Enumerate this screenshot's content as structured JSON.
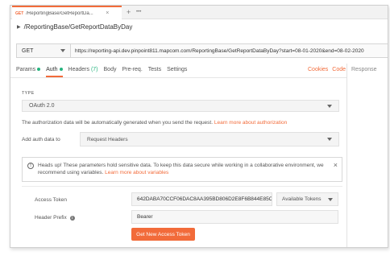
{
  "tab": {
    "method": "GET",
    "name": "/ReportingBase/GetReportDa...",
    "close_icon": "×",
    "new_tab": "+",
    "more": "•••"
  },
  "breadcrumb": {
    "title": "/ReportingBase/GetReportDataByDay"
  },
  "request": {
    "method": "GET",
    "url": "https://reporting-api.dev.pinpoint811.mapcom.com/ReportingBase/GetReportDataByDay?start=08-01-2020&end=08-02-2020"
  },
  "req_tabs": {
    "params": "Params",
    "auth": "Auth",
    "headers": "Headers",
    "headers_count": "(7)",
    "body": "Body",
    "prereq": "Pre-req.",
    "tests": "Tests",
    "settings": "Settings"
  },
  "links": {
    "cookies": "Cookies",
    "code": "Code"
  },
  "response": {
    "label": "Response"
  },
  "auth": {
    "type_label": "TYPE",
    "type_value": "OAuth 2.0",
    "info_text": "The authorization data will be automatically generated when you send the request.",
    "info_link": "Learn more about authorization",
    "add_auth_label": "Add auth data to",
    "add_auth_value": "Request Headers"
  },
  "notice": {
    "text": "Heads up! These parameters hold sensitive data. To keep this data secure while working in a collaborative environment, we recommend using variables.",
    "link": "Learn more about variables",
    "icon": "!",
    "close": "×"
  },
  "token": {
    "label": "Access Token",
    "value": "642DABA70CCF06DAC8AA395BD806D2E8F6B844E85C",
    "available_label": "Available Tokens"
  },
  "prefix": {
    "label": "Header Prefix",
    "info_icon": "i",
    "value": "Bearer"
  },
  "button": {
    "get_token": "Get New Access Token"
  },
  "colors": {
    "accent": "#f26b3a",
    "status_green": "#26b47f"
  }
}
